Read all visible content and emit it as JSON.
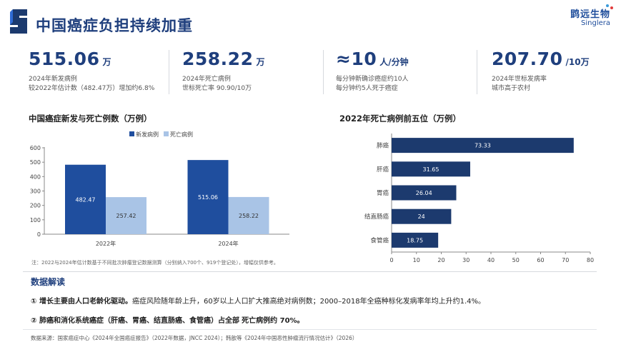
{
  "header": {
    "title": "中国癌症负担持续加重",
    "brand_cn": "鹍远生物",
    "brand_en": "Singlera"
  },
  "kpis": [
    {
      "value": "515.06",
      "unit": "万",
      "line1": "2024年新发病例",
      "line2": "较2022年估计数（482.47万）增加约6.8%"
    },
    {
      "value": "258.22",
      "unit": "万",
      "line1": "2024年死亡病例",
      "line2": "世标死亡率 90.90/10万"
    },
    {
      "value": "≈10",
      "unit": "人/分钟",
      "line1": "每分钟新确诊癌症约10人",
      "line2": "每分钟约5人死于癌症"
    },
    {
      "value": "207.70",
      "unit": "/10万",
      "line1": "2024年世标发病率",
      "line2": "城市高于农村"
    }
  ],
  "left_chart_title": "中国癌症新发与死亡例数（万例）",
  "right_chart_title": "2022年死亡病例前五位（万例）",
  "chart_data": [
    {
      "type": "bar",
      "title": "中国癌症新发与死亡例数（万例）",
      "categories": [
        "2022年",
        "2024年"
      ],
      "series": [
        {
          "name": "新发病例",
          "values": [
            482.47,
            515.06
          ],
          "color": "#1f4e9e"
        },
        {
          "name": "死亡病例",
          "values": [
            257.42,
            258.22
          ],
          "color": "#a9c4e6"
        }
      ],
      "ylim": [
        0,
        600
      ],
      "yticks": [
        "0",
        "100",
        "200",
        "300",
        "400",
        "500",
        "600"
      ],
      "legend": "top-center",
      "grid": false
    },
    {
      "type": "bar",
      "orientation": "horizontal",
      "title": "2022年死亡病例前五位（万例）",
      "categories": [
        "肺癌",
        "肝癌",
        "胃癌",
        "结直肠癌",
        "食管癌"
      ],
      "values": [
        73.33,
        31.65,
        26.04,
        24,
        18.75
      ],
      "color": "#1c3a6e",
      "xlim": [
        0,
        80
      ],
      "xticks": [
        "0",
        "10",
        "20",
        "30",
        "40",
        "50",
        "60",
        "70",
        "80"
      ],
      "grid": false
    }
  ],
  "chart_note": "注：2022与2024年估计数基于不同批次肿瘤登记数据测算（分别纳入700个、919个登记处），增幅仅供参考。",
  "interpretation": {
    "title": "数据解读",
    "item1_bold": "① 增长主要由人口老龄化驱动。",
    "item1_text": "癌症风险随年龄上升，60岁以上人口扩大推高绝对病例数；2000–2018年全癌种标化发病率年均上升约1.4%。",
    "item2_bold": "② 肺癌和消化系统癌症（肝癌、胃癌、结直肠癌、食管癌）占全部",
    "item2_text": "死亡病例约 70%。"
  },
  "source": "数据来源：国家癌症中心《2024年全国癌症报告》（2022年数据，JNCC 2024）；韩歆等《2024年中国恶性肿瘤流行情况估计》（2026）",
  "colors": {
    "navy": "#1f3f7d",
    "new_cases": "#1f4e9e",
    "deaths": "#a9c4e6",
    "hbar": "#1c3a6e"
  }
}
